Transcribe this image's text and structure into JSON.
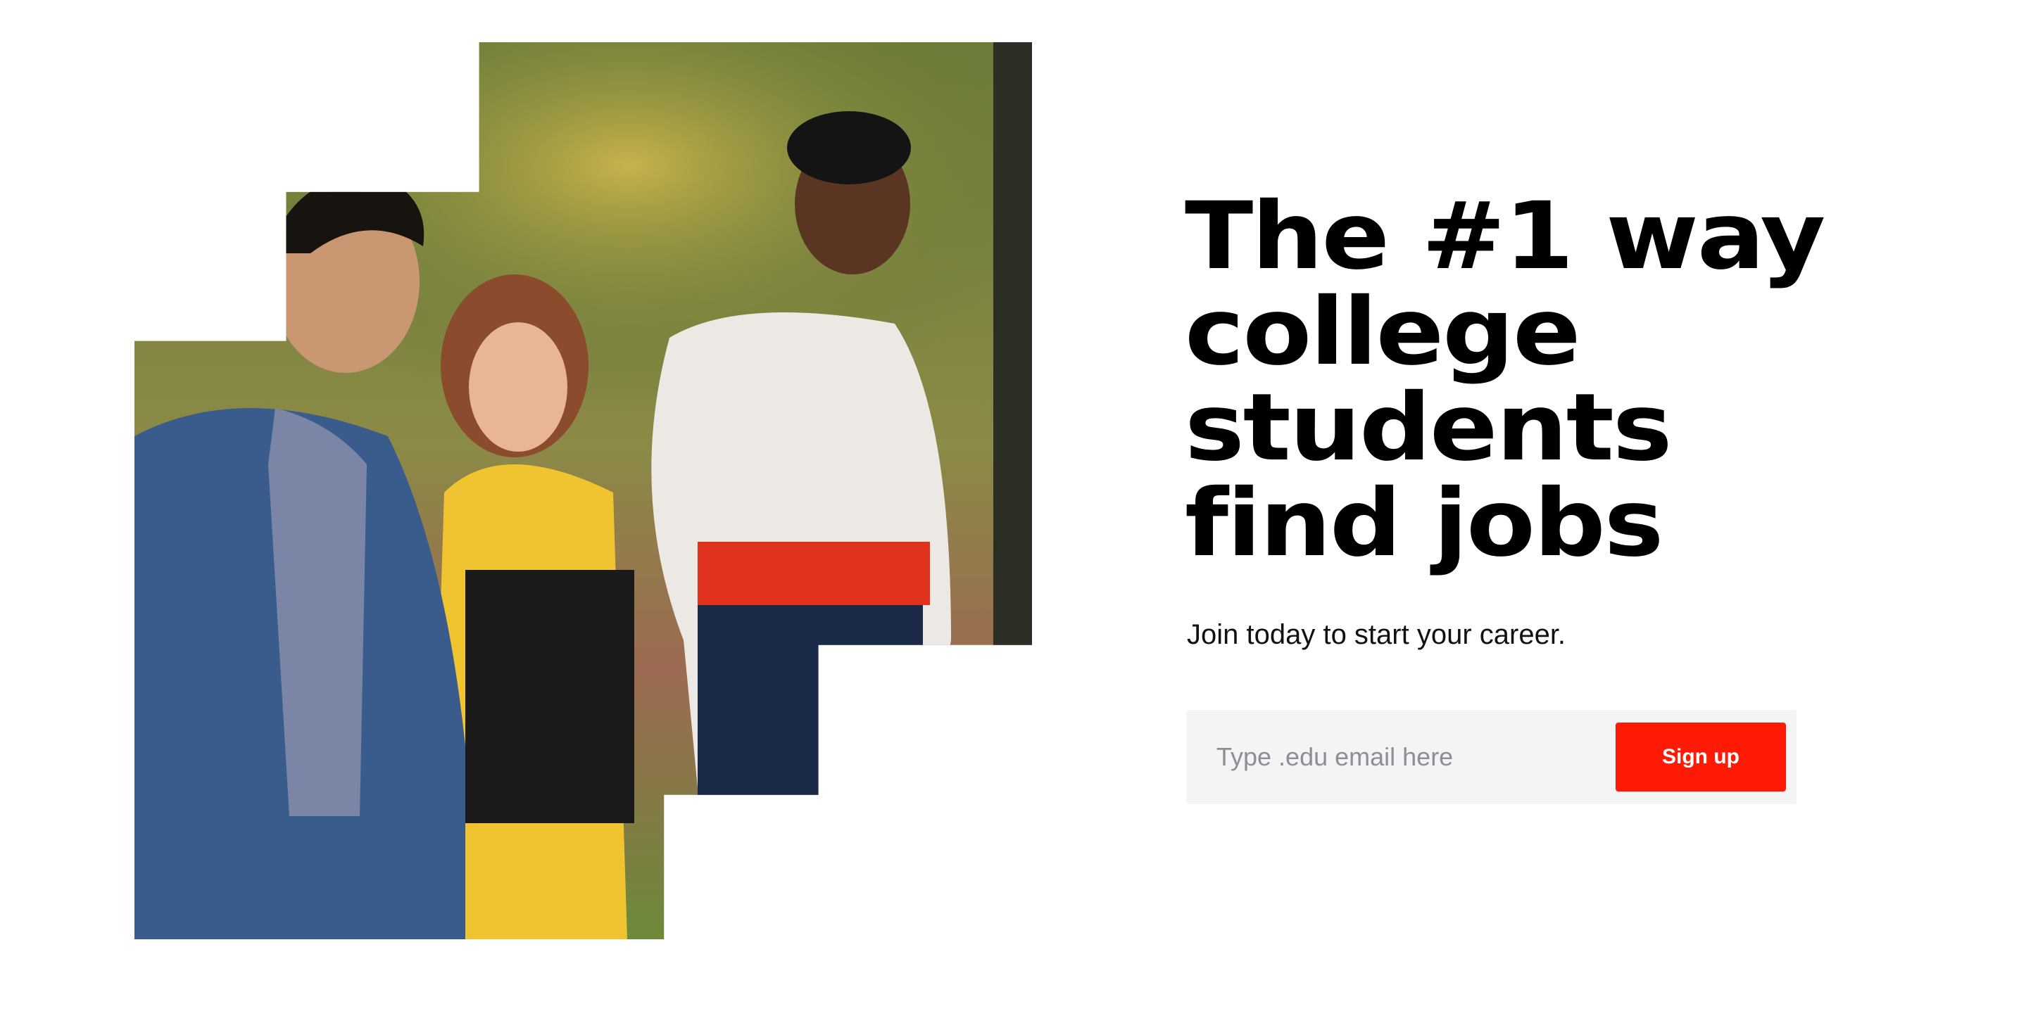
{
  "hero": {
    "headline_lines": [
      "The #1 way",
      "college",
      "students",
      "find jobs"
    ],
    "subhead": "Join today to start your career."
  },
  "signup": {
    "email_placeholder": "Type .edu email here",
    "button_label": "Sign up"
  },
  "colors": {
    "accent": "#ff1a06",
    "input_bg": "#f4f4f6",
    "text": "#000000"
  }
}
